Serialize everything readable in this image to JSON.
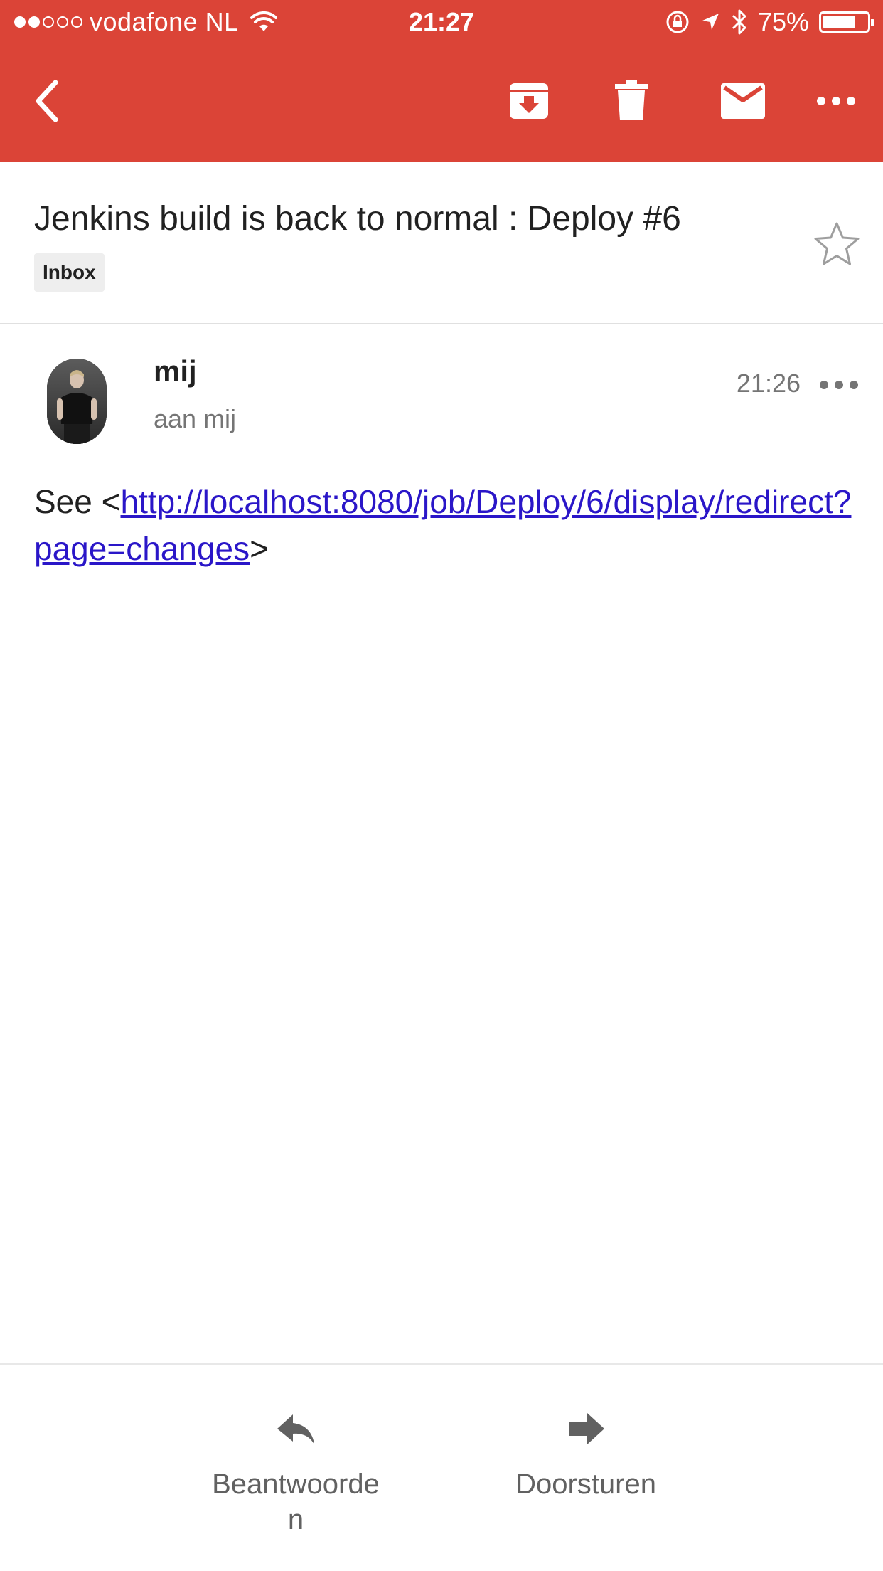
{
  "status_bar": {
    "carrier": "vodafone NL",
    "time": "21:27",
    "battery_percent": "75%",
    "battery_level": 0.75
  },
  "toolbar": {
    "icons": [
      "back-icon",
      "archive-icon",
      "trash-icon",
      "mark-unread-icon",
      "more-icon"
    ]
  },
  "email": {
    "subject": "Jenkins build is back to normal : Deploy #6",
    "label": "Inbox",
    "sender": "mij",
    "recipient": "aan mij",
    "time": "21:26",
    "body_prefix": "See <",
    "body_link": "http://localhost:8080/job/Deploy/6/display/redirect?page=changes",
    "body_suffix": ">"
  },
  "actions": {
    "reply_label": "Beantwoorden",
    "forward_label": "Doorsturen"
  },
  "colors": {
    "brand_red": "#db4437",
    "link": "#2a16c8"
  }
}
